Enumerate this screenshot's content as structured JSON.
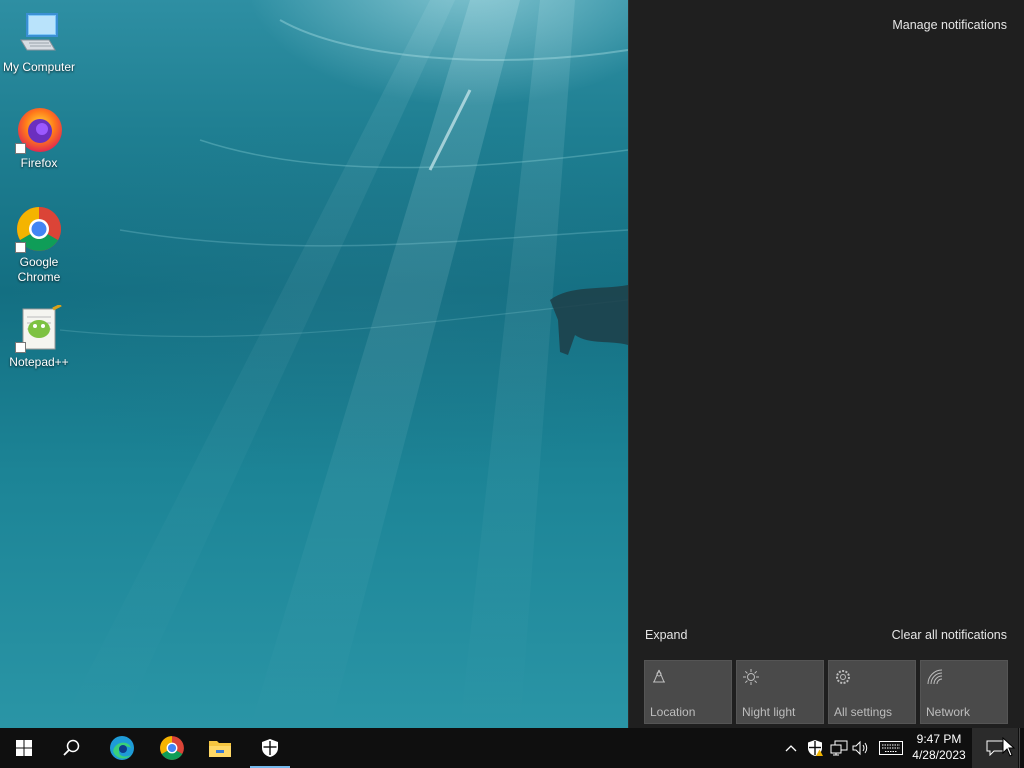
{
  "desktop": {
    "icons": [
      {
        "label": "My Computer",
        "icon": "my-computer-icon"
      },
      {
        "label": "Firefox",
        "icon": "firefox-icon"
      },
      {
        "label": "Google Chrome",
        "icon": "chrome-icon"
      },
      {
        "label": "Notepad++",
        "icon": "notepadpp-icon"
      }
    ]
  },
  "action_center": {
    "manage_label": "Manage notifications",
    "expand_label": "Expand",
    "clear_label": "Clear all notifications",
    "tiles": [
      {
        "label": "Location",
        "icon": "location-icon"
      },
      {
        "label": "Night light",
        "icon": "night-light-icon"
      },
      {
        "label": "All settings",
        "icon": "settings-icon"
      },
      {
        "label": "Network",
        "icon": "network-icon"
      }
    ]
  },
  "taskbar": {
    "pinned": [
      "start-icon",
      "search-icon",
      "edge-icon",
      "chrome-icon",
      "file-explorer-icon",
      "security-icon"
    ],
    "tray": [
      "chevron-up-icon",
      "windows-security-warning-icon",
      "network-wired-icon",
      "volume-icon",
      "keyboard-icon"
    ],
    "time": "9:47 PM",
    "date": "4/28/2023",
    "accent": "#76b9ed"
  }
}
